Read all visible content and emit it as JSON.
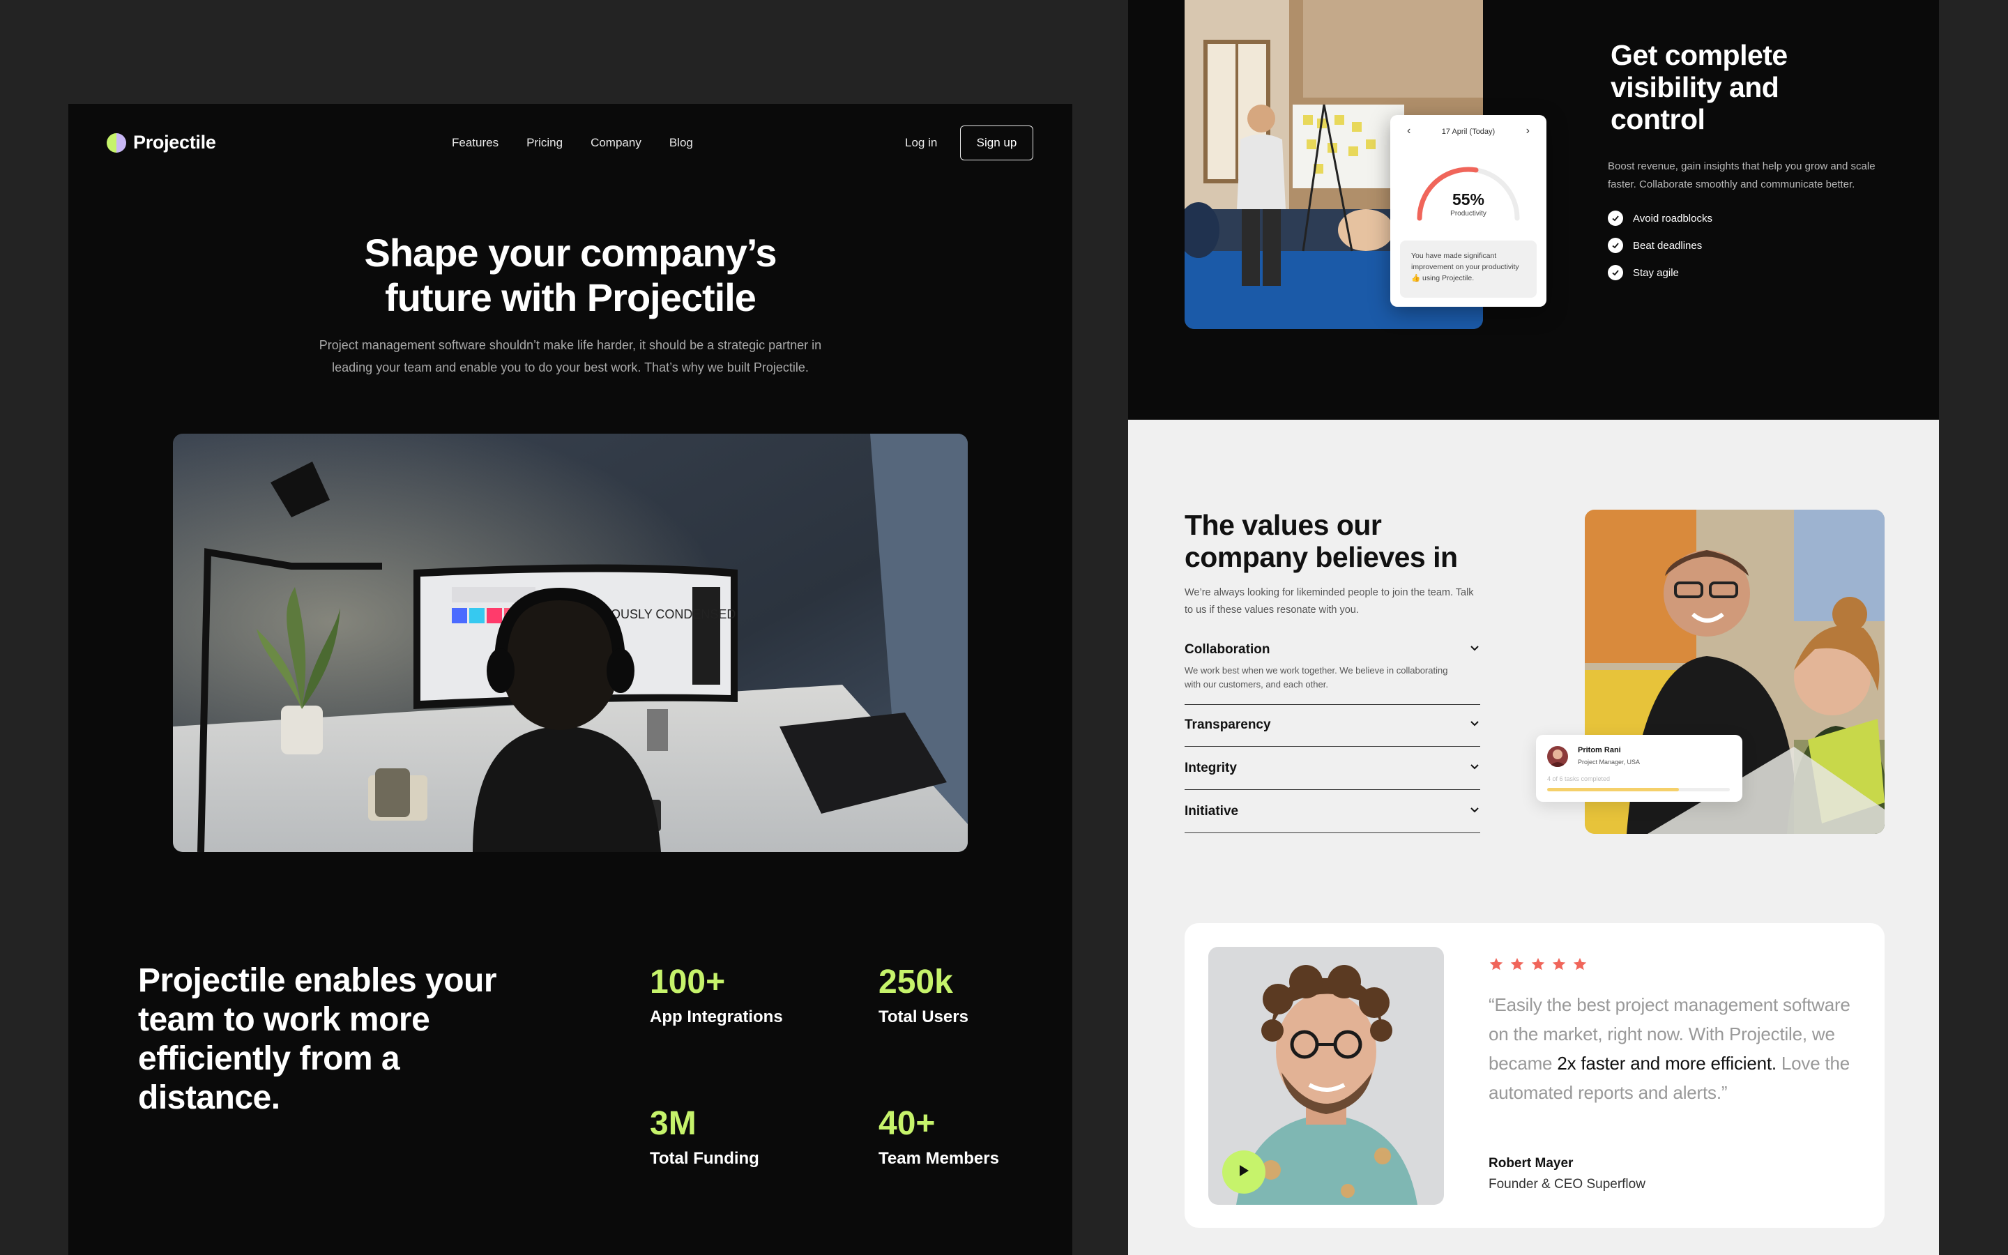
{
  "nav": {
    "brand": "Projectile",
    "links": [
      "Features",
      "Pricing",
      "Company",
      "Blog"
    ],
    "login": "Log in",
    "signup": "Sign up"
  },
  "hero": {
    "title_line1": "Shape your company’s",
    "title_line2": "future with Projectile",
    "subtitle_line1": "Project management software shouldn’t make life harder, it should be a strategic partner in",
    "subtitle_line2": "leading your team and enable you to do your best work. That’s why we built Projectile."
  },
  "monitor_text": "OBVIOUSLY CONDENSED",
  "enable": {
    "headline": "Projectile enables your team to work more efficiently from a distance."
  },
  "stats": [
    {
      "value": "100+",
      "label": "App Integrations"
    },
    {
      "value": "250k",
      "label": "Total Users"
    },
    {
      "value": "3M",
      "label": "Total Funding"
    },
    {
      "value": "40+",
      "label": "Team Members"
    }
  ],
  "productivity_card": {
    "date": "17 April (Today)",
    "percent": "55%",
    "progress": 0.55,
    "label": "Productivity",
    "message": "You have made significant improvement on your productivity 👍 using Projectile."
  },
  "visibility": {
    "title": "Get complete visibility and control",
    "subtitle": "Boost revenue, gain insights that help you grow and scale faster. Collaborate smoothly and communicate better.",
    "checks": [
      "Avoid roadblocks",
      "Beat deadlines",
      "Stay agile"
    ]
  },
  "values": {
    "title": "The values our company believes in",
    "subtitle": "We’re always looking for likeminded people to join the team. Talk to us if these values resonate with you.",
    "items": [
      {
        "title": "Collaboration",
        "body": "We work best when we work together. We believe in collaborating with our customers, and each other."
      },
      {
        "title": "Transparency"
      },
      {
        "title": "Integrity"
      },
      {
        "title": "Initiative"
      }
    ]
  },
  "person_card": {
    "name": "Pritom Rani",
    "role": "Project Manager, USA",
    "tasks": "4 of 6 tasks completed",
    "progress": 0.72
  },
  "testimonial": {
    "rating": 5,
    "quote_pre": "“Easily the best project management software on the market, right now. With Projectile, we became ",
    "quote_bold": "2x faster and more efficient.",
    "quote_post": " Love the automated reports and alerts.”",
    "author": "Robert Mayer",
    "role": "Founder & CEO Superflow"
  },
  "colors": {
    "accent_green": "#c6f36b",
    "accent_purple": "#c9b8f5",
    "star": "#f0655a",
    "dark_bg": "#0a0a0a",
    "light_bg": "#f0f0f0"
  }
}
